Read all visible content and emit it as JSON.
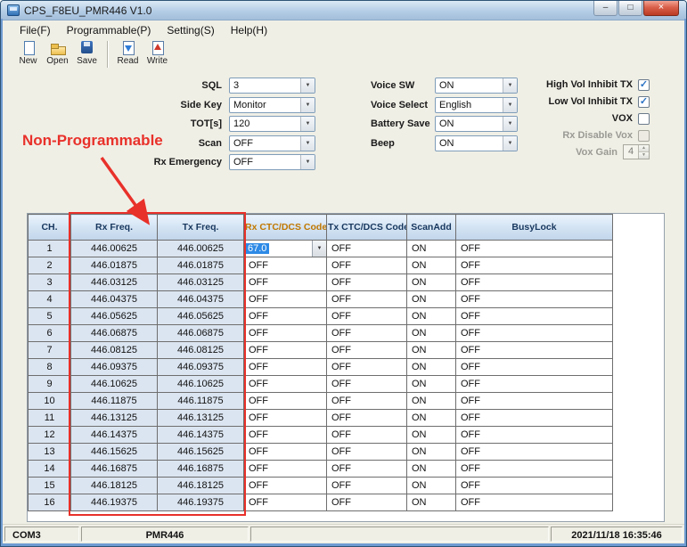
{
  "window": {
    "title": "CPS_F8EU_PMR446 V1.0",
    "controls": {
      "minimize": "–",
      "maximize": "□",
      "close": "×"
    }
  },
  "menu": {
    "items": [
      {
        "label": "File(F)"
      },
      {
        "label": "Programmable(P)"
      },
      {
        "label": "Setting(S)"
      },
      {
        "label": "Help(H)"
      }
    ]
  },
  "toolbar": {
    "buttons": [
      {
        "label": "New",
        "icon": "new-file-icon",
        "group": 1
      },
      {
        "label": "Open",
        "icon": "open-folder-icon",
        "group": 1
      },
      {
        "label": "Save",
        "icon": "save-file-icon",
        "group": 1
      },
      {
        "label": "Read",
        "icon": "read-from-radio-icon",
        "group": 2
      },
      {
        "label": "Write",
        "icon": "write-to-radio-icon",
        "group": 2
      }
    ]
  },
  "settings": {
    "selects_left": [
      {
        "label": "SQL",
        "value": "3"
      },
      {
        "label": "Side Key",
        "value": "Monitor"
      },
      {
        "label": "TOT[s]",
        "value": "120"
      },
      {
        "label": "Scan",
        "value": "OFF"
      },
      {
        "label": "Rx Emergency",
        "value": "OFF"
      }
    ],
    "selects_middle": [
      {
        "label": "Voice SW",
        "value": "ON"
      },
      {
        "label": "Voice Select",
        "value": "English"
      },
      {
        "label": "Battery Save",
        "value": "ON"
      },
      {
        "label": "Beep",
        "value": "ON"
      }
    ],
    "checkboxes": [
      {
        "label": "High Vol Inhibit TX",
        "checked": true,
        "enabled": true
      },
      {
        "label": "Low Vol Inhibit TX",
        "checked": true,
        "enabled": true
      },
      {
        "label": "VOX",
        "checked": false,
        "enabled": true
      },
      {
        "label": "Rx Disable Vox",
        "checked": false,
        "enabled": false
      }
    ],
    "vox_gain": {
      "label": "Vox Gain",
      "value": "4",
      "enabled": false
    }
  },
  "annotation": {
    "label": "Non-Programmable",
    "color": "#e8312a"
  },
  "table": {
    "headers": [
      "CH.",
      "Rx Freq.",
      "Tx Freq.",
      "Rx CTC/DCS Code",
      "Tx CTC/DCS Code",
      "ScanAdd",
      "BusyLock"
    ],
    "highlighted_column": "Rx CTC/DCS Code",
    "active_row": 1,
    "rows": [
      {
        "ch": "1",
        "rx_freq": "446.00625",
        "tx_freq": "446.00625",
        "rx_code": "67.0",
        "tx_code": "OFF",
        "scan_add": "ON",
        "busy_lock": "OFF"
      },
      {
        "ch": "2",
        "rx_freq": "446.01875",
        "tx_freq": "446.01875",
        "rx_code": "OFF",
        "tx_code": "OFF",
        "scan_add": "ON",
        "busy_lock": "OFF"
      },
      {
        "ch": "3",
        "rx_freq": "446.03125",
        "tx_freq": "446.03125",
        "rx_code": "OFF",
        "tx_code": "OFF",
        "scan_add": "ON",
        "busy_lock": "OFF"
      },
      {
        "ch": "4",
        "rx_freq": "446.04375",
        "tx_freq": "446.04375",
        "rx_code": "OFF",
        "tx_code": "OFF",
        "scan_add": "ON",
        "busy_lock": "OFF"
      },
      {
        "ch": "5",
        "rx_freq": "446.05625",
        "tx_freq": "446.05625",
        "rx_code": "OFF",
        "tx_code": "OFF",
        "scan_add": "ON",
        "busy_lock": "OFF"
      },
      {
        "ch": "6",
        "rx_freq": "446.06875",
        "tx_freq": "446.06875",
        "rx_code": "OFF",
        "tx_code": "OFF",
        "scan_add": "ON",
        "busy_lock": "OFF"
      },
      {
        "ch": "7",
        "rx_freq": "446.08125",
        "tx_freq": "446.08125",
        "rx_code": "OFF",
        "tx_code": "OFF",
        "scan_add": "ON",
        "busy_lock": "OFF"
      },
      {
        "ch": "8",
        "rx_freq": "446.09375",
        "tx_freq": "446.09375",
        "rx_code": "OFF",
        "tx_code": "OFF",
        "scan_add": "ON",
        "busy_lock": "OFF"
      },
      {
        "ch": "9",
        "rx_freq": "446.10625",
        "tx_freq": "446.10625",
        "rx_code": "OFF",
        "tx_code": "OFF",
        "scan_add": "ON",
        "busy_lock": "OFF"
      },
      {
        "ch": "10",
        "rx_freq": "446.11875",
        "tx_freq": "446.11875",
        "rx_code": "OFF",
        "tx_code": "OFF",
        "scan_add": "ON",
        "busy_lock": "OFF"
      },
      {
        "ch": "11",
        "rx_freq": "446.13125",
        "tx_freq": "446.13125",
        "rx_code": "OFF",
        "tx_code": "OFF",
        "scan_add": "ON",
        "busy_lock": "OFF"
      },
      {
        "ch": "12",
        "rx_freq": "446.14375",
        "tx_freq": "446.14375",
        "rx_code": "OFF",
        "tx_code": "OFF",
        "scan_add": "ON",
        "busy_lock": "OFF"
      },
      {
        "ch": "13",
        "rx_freq": "446.15625",
        "tx_freq": "446.15625",
        "rx_code": "OFF",
        "tx_code": "OFF",
        "scan_add": "ON",
        "busy_lock": "OFF"
      },
      {
        "ch": "14",
        "rx_freq": "446.16875",
        "tx_freq": "446.16875",
        "rx_code": "OFF",
        "tx_code": "OFF",
        "scan_add": "ON",
        "busy_lock": "OFF"
      },
      {
        "ch": "15",
        "rx_freq": "446.18125",
        "tx_freq": "446.18125",
        "rx_code": "OFF",
        "tx_code": "OFF",
        "scan_add": "ON",
        "busy_lock": "OFF"
      },
      {
        "ch": "16",
        "rx_freq": "446.19375",
        "tx_freq": "446.19375",
        "rx_code": "OFF",
        "tx_code": "OFF",
        "scan_add": "ON",
        "busy_lock": "OFF"
      }
    ]
  },
  "statusbar": {
    "port": "COM3",
    "model": "PMR446",
    "datetime": "2021/11/18 16:35:46"
  }
}
